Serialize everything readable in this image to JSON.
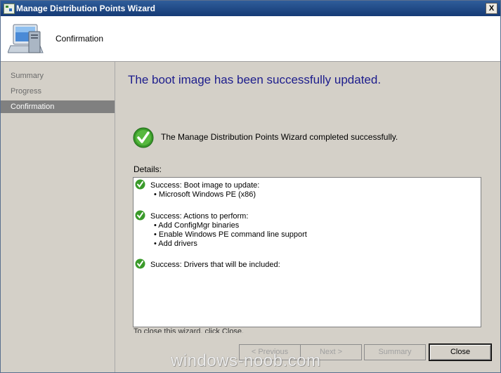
{
  "window": {
    "title": "Manage Distribution Points Wizard",
    "close_label": "X"
  },
  "header": {
    "title": "Confirmation",
    "icon": "computer-icon"
  },
  "sidebar": {
    "items": [
      {
        "label": "Summary",
        "selected": false
      },
      {
        "label": "Progress",
        "selected": false
      },
      {
        "label": "Confirmation",
        "selected": true
      }
    ]
  },
  "main": {
    "heading": "The boot image has been successfully updated.",
    "success_message": "The Manage Distribution Points Wizard completed successfully.",
    "details_label": "Details:",
    "details": [
      {
        "title": "Success: Boot image to update:",
        "items": [
          "• Microsoft Windows PE (x86)"
        ]
      },
      {
        "title": "Success: Actions to perform:",
        "items": [
          "• Add ConfigMgr binaries",
          "• Enable Windows PE command line support",
          "• Add drivers"
        ]
      },
      {
        "title": "Success: Drivers that will be included:",
        "items": []
      }
    ],
    "cutoff_text": "To close this wizard, click Close."
  },
  "buttons": {
    "previous": "< Previous",
    "next": "Next >",
    "summary": "Summary",
    "close": "Close"
  },
  "watermark": "windows-noob.com",
  "colors": {
    "titlebar": "#1f4a8a",
    "heading": "#1c1c8c",
    "selected_nav": "#808080",
    "success_green": "#3a9a2a"
  }
}
